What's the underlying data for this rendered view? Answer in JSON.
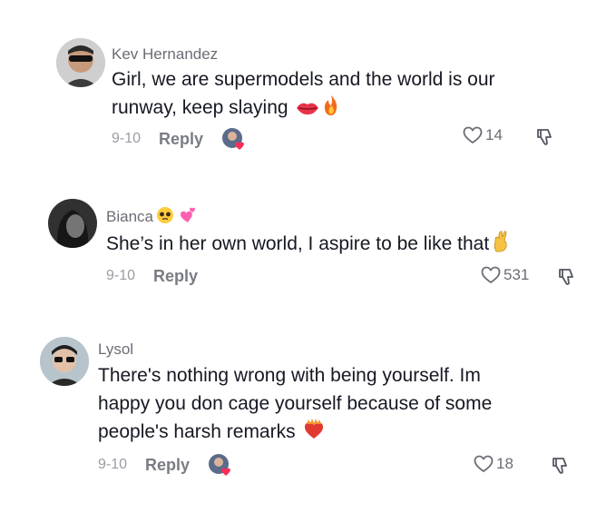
{
  "comments": [
    {
      "username": "Kev Hernandez",
      "text_line1": "Girl, we are supermodels and the world is our",
      "text_line2": "runway, keep slaying",
      "date": "9-10",
      "reply_label": "Reply",
      "likes": "14",
      "emojis": [
        "lips-emoji",
        "fire-emoji"
      ],
      "has_creator_like": true
    },
    {
      "username": "Bianca",
      "username_emojis": [
        "pleading-face-emoji",
        "two-hearts-emoji"
      ],
      "text_line1": "She’s in her own world, I aspire to be like that",
      "date": "9-10",
      "reply_label": "Reply",
      "likes": "531",
      "emojis": [
        "crossed-fingers-emoji"
      ],
      "has_creator_like": false
    },
    {
      "username": "Lysol",
      "text_line1": "There's nothing wrong with being yourself. Im",
      "text_line2": "happy you don cage yourself because of some",
      "text_line3": "people's harsh remarks",
      "date": "9-10",
      "reply_label": "Reply",
      "likes": "18",
      "emojis": [
        "heart-on-fire-emoji"
      ],
      "has_creator_like": true
    }
  ],
  "colors": {
    "text": "#161823",
    "secondary": "#6b6d75",
    "muted": "#9a9ca3",
    "background": "#ffffff"
  },
  "icons": [
    "heart-outline-icon",
    "thumbs-down-icon",
    "creator-liked-avatar-icon"
  ]
}
